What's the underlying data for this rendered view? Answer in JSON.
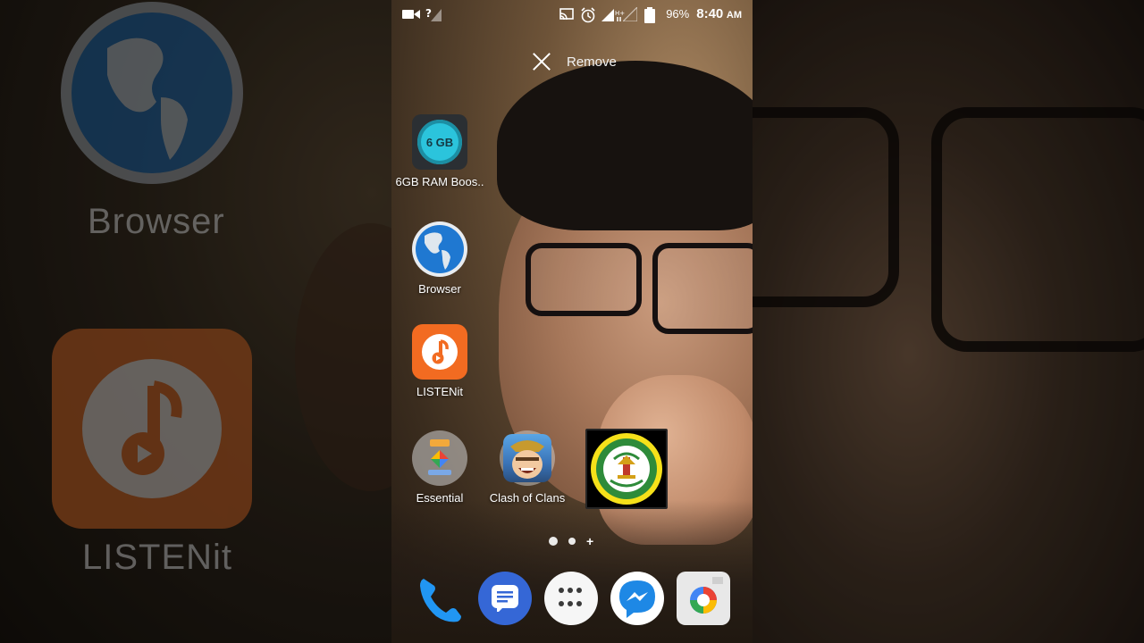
{
  "status_bar": {
    "battery_percent": "96%",
    "time": "8:40",
    "ampm": "AM"
  },
  "remove_bar": {
    "label": "Remove"
  },
  "home_apps": [
    {
      "label": "6GB RAM Boos..",
      "icon_text": "6 GB",
      "icon": "ram-booster-icon"
    },
    {
      "label": "Browser",
      "icon": "globe-icon"
    },
    {
      "label": "LISTENit",
      "icon": "music-note-icon"
    },
    {
      "label": "Essential",
      "icon": "folder-icon"
    },
    {
      "label": "Clash of Clans",
      "icon": "clash-of-clans-icon"
    },
    {
      "label": "",
      "icon": "school-seal-icon"
    }
  ],
  "page_indicator": {
    "pages": 2,
    "active": 1,
    "add_symbol": "+"
  },
  "dock": [
    {
      "name": "phone",
      "icon": "phone-icon"
    },
    {
      "name": "messages",
      "icon": "messages-icon"
    },
    {
      "name": "all-apps",
      "icon": "app-drawer-icon"
    },
    {
      "name": "messenger",
      "icon": "messenger-icon"
    },
    {
      "name": "camera",
      "icon": "camera-icon"
    }
  ],
  "background_blur": {
    "left_label_top": "Browser",
    "left_label_bottom": "LISTENit"
  },
  "colors": {
    "listen_orange": "#f26b21",
    "browser_blue": "#1f78d1",
    "messages_blue": "#3567d6",
    "ram_cyan": "#2bc4dc"
  }
}
